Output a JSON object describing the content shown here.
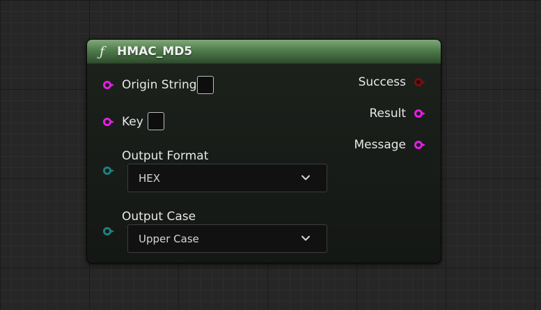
{
  "node": {
    "icon": "function-icon",
    "icon_glyph": "ƒ",
    "title": "HMAC_MD5",
    "header_color": "#5a8a55"
  },
  "inputs": {
    "origin_string": {
      "label": "Origin String",
      "pin_color": "#e61ee6"
    },
    "key": {
      "label": "Key",
      "pin_color": "#e61ee6"
    },
    "output_format": {
      "label": "Output Format",
      "value": "HEX",
      "pin_color": "#1b8282"
    },
    "output_case": {
      "label": "Output Case",
      "value": "Upper Case",
      "pin_color": "#1b8282"
    }
  },
  "outputs": {
    "success": {
      "label": "Success",
      "pin_color": "#7a0f0f"
    },
    "result": {
      "label": "Result",
      "pin_color": "#e61ee6"
    },
    "message": {
      "label": "Message",
      "pin_color": "#e61ee6"
    }
  }
}
